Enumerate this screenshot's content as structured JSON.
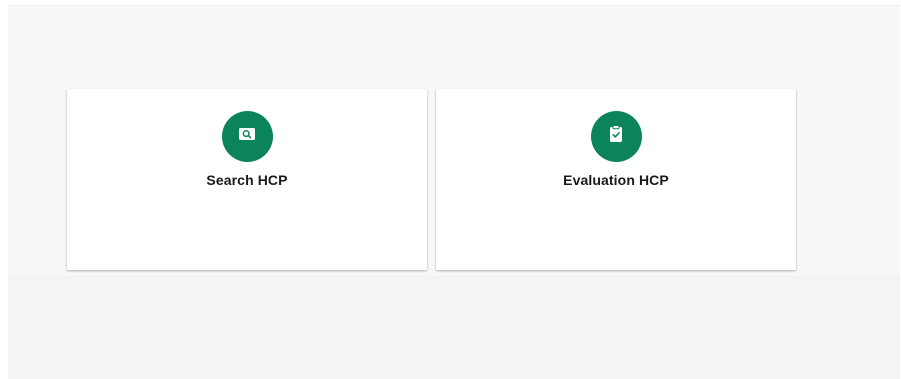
{
  "colors": {
    "accent": "#0a8458",
    "page_background": "#f4f4f4",
    "card_background": "#ffffff",
    "label_text": "#1a1a1a"
  },
  "cards": [
    {
      "label": "Search HCP",
      "icon": "search-folder-icon"
    },
    {
      "label": "Evaluation HCP",
      "icon": "clipboard-check-icon"
    }
  ]
}
